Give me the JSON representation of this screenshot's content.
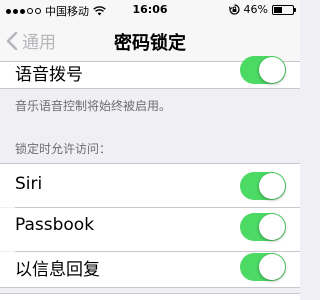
{
  "status_bar": {
    "carrier": "中国移动",
    "time": "16:06",
    "battery_percent_label": "46%",
    "battery_level": 0.46,
    "signal_bars_filled": 3,
    "signal_bars_total": 5
  },
  "nav": {
    "back_label": "通用",
    "title": "密码锁定"
  },
  "voice_dial": {
    "label": "语音拨号",
    "enabled": true,
    "footer": "音乐语音控制将始终被启用。"
  },
  "locked_access": {
    "header": "锁定时允许访问：",
    "items": [
      {
        "label": "Siri",
        "enabled": true
      },
      {
        "label": "Passbook",
        "enabled": true
      },
      {
        "label": "以信息回复",
        "enabled": true
      }
    ]
  },
  "colors": {
    "toggle_on": "#4cd964",
    "background": "#efeff4",
    "back_text": "#b6b6bb"
  }
}
